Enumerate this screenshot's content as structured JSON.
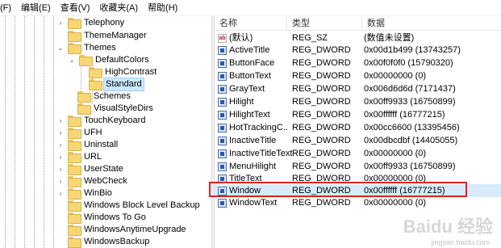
{
  "menubar": {
    "items": [
      "(F)",
      "编辑(E)",
      "查看(V)",
      "收藏夹(A)",
      "帮助(H)"
    ]
  },
  "tree": {
    "items": [
      {
        "label": "Telephony",
        "expander": "›"
      },
      {
        "label": "ThemeManager",
        "expander": ""
      },
      {
        "label": "Themes",
        "expander": "⌄"
      },
      {
        "label": "DefaultColors",
        "expander": "⌄"
      },
      {
        "label": "HighContrast",
        "expander": ""
      },
      {
        "label": "Standard",
        "expander": ""
      },
      {
        "label": "Schemes",
        "expander": ""
      },
      {
        "label": "VisualStyleDirs",
        "expander": ""
      },
      {
        "label": "TouchKeyboard",
        "expander": "›"
      },
      {
        "label": "UFH",
        "expander": "›"
      },
      {
        "label": "Uninstall",
        "expander": "›"
      },
      {
        "label": "URL",
        "expander": "›"
      },
      {
        "label": "UserState",
        "expander": "›"
      },
      {
        "label": "WebCheck",
        "expander": "›"
      },
      {
        "label": "WinBio",
        "expander": "›"
      },
      {
        "label": "Windows Block Level Backup",
        "expander": ""
      },
      {
        "label": "Windows To Go",
        "expander": ""
      },
      {
        "label": "WindowsAnytimeUpgrade",
        "expander": ""
      },
      {
        "label": "WindowsBackup",
        "expander": ""
      }
    ]
  },
  "list": {
    "headers": {
      "name": "名称",
      "type": "类型",
      "data": "数据"
    },
    "rows": [
      {
        "name": "(默认)",
        "type": "REG_SZ",
        "data": "(数值未设置)",
        "icon": "string-value-icon"
      },
      {
        "name": "ActiveTitle",
        "type": "REG_DWORD",
        "data": "0x00d1b499 (13743257)",
        "icon": "binary-value-icon"
      },
      {
        "name": "ButtonFace",
        "type": "REG_DWORD",
        "data": "0x00f0f0f0 (15790320)",
        "icon": "binary-value-icon"
      },
      {
        "name": "ButtonText",
        "type": "REG_DWORD",
        "data": "0x00000000 (0)",
        "icon": "binary-value-icon"
      },
      {
        "name": "GrayText",
        "type": "REG_DWORD",
        "data": "0x006d6d6d (7171437)",
        "icon": "binary-value-icon"
      },
      {
        "name": "Hilight",
        "type": "REG_DWORD",
        "data": "0x00ff9933 (16750899)",
        "icon": "binary-value-icon"
      },
      {
        "name": "HilightText",
        "type": "REG_DWORD",
        "data": "0x00ffffff (16777215)",
        "icon": "binary-value-icon"
      },
      {
        "name": "HotTrackingC...",
        "type": "REG_DWORD",
        "data": "0x00cc6600 (13395456)",
        "icon": "binary-value-icon"
      },
      {
        "name": "InactiveTitle",
        "type": "REG_DWORD",
        "data": "0x00dbcdbf (14405055)",
        "icon": "binary-value-icon"
      },
      {
        "name": "InactiveTitleText",
        "type": "REG_DWORD",
        "data": "0x00000000 (0)",
        "icon": "binary-value-icon"
      },
      {
        "name": "MenuHilight",
        "type": "REG_DWORD",
        "data": "0x00ff9933 (16750899)",
        "icon": "binary-value-icon"
      },
      {
        "name": "TitleText",
        "type": "REG_DWORD",
        "data": "0x00000000 (0)",
        "icon": "binary-value-icon"
      },
      {
        "name": "Window",
        "type": "REG_DWORD",
        "data": "0x00ffffff (16777215)",
        "icon": "binary-value-icon"
      },
      {
        "name": "WindowText",
        "type": "REG_DWORD",
        "data": "0x00000000 (0)",
        "icon": "binary-value-icon"
      }
    ]
  },
  "colors": {
    "selection": "#cce8ff",
    "highlight_border": "#e02020",
    "folder": "#f7d774"
  },
  "watermark": {
    "main": "Baidu 经验",
    "sub": "jingyan.baidu.com"
  }
}
